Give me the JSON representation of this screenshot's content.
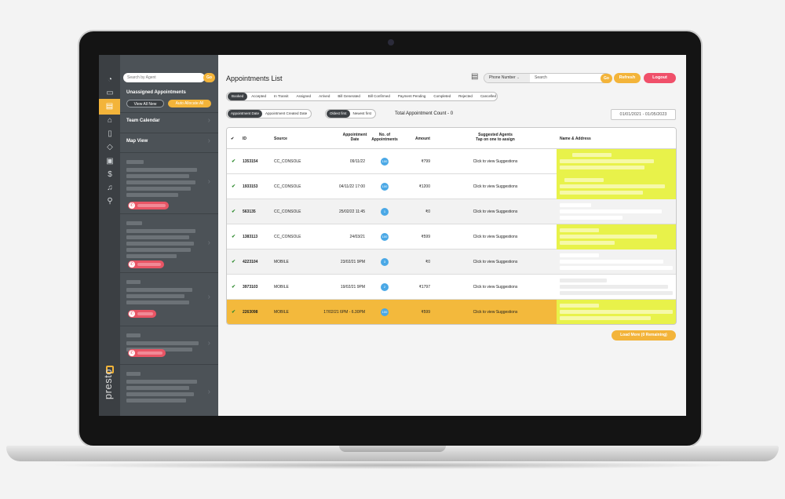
{
  "app": {
    "brand": "presto"
  },
  "sidebar": {
    "search_placeholder": "Search by Agent",
    "go_label": "Go",
    "unassigned_title": "Unassigned Appointments",
    "view_all_label": "View All New",
    "auto_allocate_label": "Auto Allocate All",
    "team_calendar_label": "Team Calendar",
    "map_view_label": "Map View"
  },
  "header": {
    "title": "Appointments List",
    "phone_select": "Phone Number",
    "search_placeholder": "Search",
    "go_label": "Go",
    "refresh_label": "Refresh",
    "logout_label": "Logout"
  },
  "status_tabs": [
    "Booked",
    "Accepted",
    "In Transit",
    "Assigned",
    "Arrived",
    "Bill Generated",
    "Bill Confirmed",
    "Payment Pending",
    "Completed",
    "Rejected",
    "Cancelled"
  ],
  "date_toggle": [
    "Appointment Date",
    "Appointment Created Date"
  ],
  "sort_toggle": [
    "Oldest first",
    "Newest first"
  ],
  "total_count": "Total Appointment Count - 0",
  "date_range": "01/01/2021 - 01/05/2023",
  "table": {
    "headers": {
      "check": "✔",
      "id": "ID",
      "source": "Source",
      "date_1": "Appointment",
      "date_2": "Date",
      "count_1": "No. of",
      "count_2": "Appointments",
      "amount": "Amount",
      "agents_1": "Suggested Agents",
      "agents_2": "Tap on one to assign",
      "name_address": "Name & Address"
    },
    "rows": [
      {
        "id": "1353154",
        "source": "CC_CONSOLE",
        "date": "09/11/22",
        "count": "100",
        "amount": "₹799",
        "agents": "Click to view Suggestions"
      },
      {
        "id": "1933153",
        "source": "CC_CONSOLE",
        "date": "04/11/22 17:00",
        "count": "100",
        "amount": "₹1200",
        "agents": "Click to view Suggestions"
      },
      {
        "id": "563135",
        "source": "CC_CONSOLE",
        "date": "25/02/22 11:45",
        "count": "1",
        "amount": "₹0",
        "agents": "Click to view Suggestions"
      },
      {
        "id": "1383113",
        "source": "CC_CONSOLE",
        "date": "24/03/21",
        "count": "100",
        "amount": "₹599",
        "agents": "Click to view Suggestions"
      },
      {
        "id": "4223104",
        "source": "MOBILE",
        "date": "23/02/21 9PM",
        "count": "3",
        "amount": "₹0",
        "agents": "Click to view Suggestions"
      },
      {
        "id": "3973103",
        "source": "MOBILE",
        "date": "19/02/21 9PM",
        "count": "2",
        "amount": "₹1797",
        "agents": "Click to view Suggestions"
      },
      {
        "id": "2263098",
        "source": "MOBILE",
        "date": "17/02/21 6PM - 6.30PM",
        "count": "100",
        "amount": "₹599",
        "agents": "Click to view Suggestions"
      }
    ]
  },
  "load_more_label": "Load More (0 Remaining)",
  "colors": {
    "accent": "#f3b43a",
    "danger": "#f0506a",
    "highlight": "#e8f24a",
    "sidebar": "#4c5257"
  }
}
